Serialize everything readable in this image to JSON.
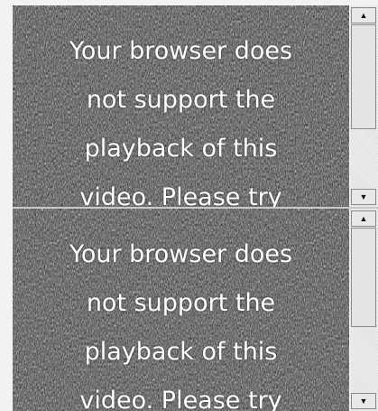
{
  "videos": [
    {
      "message_lines": [
        "Your browser does",
        "not support the",
        "playback of this",
        "video. Please try"
      ],
      "scrollbar_up_icon": "arrow-up-icon",
      "scrollbar_down_icon": "arrow-down-icon"
    },
    {
      "message_lines": [
        "Your browser does",
        "not support the",
        "playback of this",
        "video. Please try"
      ],
      "scrollbar_up_icon": "arrow-up-icon",
      "scrollbar_down_icon": "arrow-down-icon"
    }
  ],
  "colors": {
    "page_background": "#f2f2f2",
    "noise_background": "#3a3a3a",
    "text": "#ffffff"
  },
  "glyphs": {
    "arrow_up": "▲",
    "arrow_down": "▼"
  }
}
